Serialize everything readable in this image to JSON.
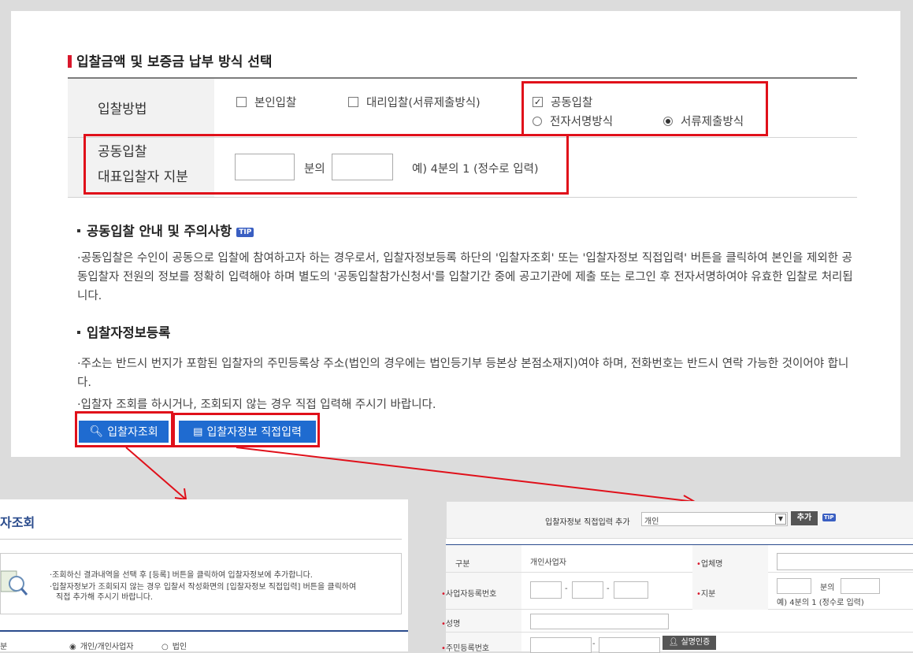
{
  "section_title": "입찰금액 및 보증금 납부 방식 선택",
  "bid_method": {
    "label": "입찰방법",
    "options": [
      {
        "label": "본인입찰",
        "checked": false
      },
      {
        "label": "대리입찰(서류제출방식)",
        "checked": false
      },
      {
        "label": "공동입찰",
        "checked": true
      }
    ],
    "sub_options": [
      {
        "label": "전자서명방식",
        "selected": false
      },
      {
        "label": "서류제출방식",
        "selected": true
      }
    ]
  },
  "joint_share": {
    "label_line1": "공동입찰",
    "label_line2": "대표입찰자 지분",
    "between_text": "분의",
    "example": "예) 4분의 1 (정수로 입력)"
  },
  "guide": {
    "title": "공동입찰 안내 및 주의사항",
    "tip": "TIP",
    "text": "·공동입찰은 수인이 공동으로 입찰에 참여하고자 하는 경우로서, 입찰자정보등록 하단의 '입찰자조회' 또는 '입찰자정보 직접입력' 버튼을 클릭하여 본인을 제외한 공동입찰자 전원의 정보를 정확히 입력해야 하며 별도의 '공동입찰참가신청서'를 입찰기간 중에 공고기관에 제출 또는 로그인 후 전자서명하여야 유효한 입찰로 처리됩니다."
  },
  "register": {
    "title": "입찰자정보등록",
    "note1": "·주소는 반드시 번지가 포함된 입찰자의 주민등록상 주소(법인의 경우에는 법인등기부 등본상 본점소재지)여야 하며, 전화번호는 반드시 연락 가능한 것이어야 합니다.",
    "note2": "·입찰자 조회를 하시거나, 조회되지 않는 경우 직접 입력해 주시기 바랍니다.",
    "search_button": "입찰자조회",
    "direct_button": "입찰자정보 직접입력"
  },
  "search_dialog": {
    "title": "자조회",
    "info1": "·조회하신 결과내역을 선택 후 [등록] 버튼을 클릭하여 입찰자정보에 추가합니다.",
    "info2": "·입찰자정보가 조회되지 않는 경우 입찰서 작성화면의 [입찰자정보 직접입력] 버튼을 클릭하여",
    "info3": "직접 추가해 주시기 바랍니다.",
    "row_label": "분",
    "radio1": "개인/개인사업자",
    "radio2": "법인"
  },
  "direct_panel": {
    "add_label": "입찰자정보 직접입력 추가",
    "select_value": "개인",
    "add_button": "추가",
    "tip": "TIP",
    "type_label": "구분",
    "type_value": "개인사업자",
    "company_label": "업체명",
    "bizno_label": "사업자등록번호",
    "share_label": "지분",
    "share_between": "분의",
    "share_example": "예) 4분의 1 (정수로 입력)",
    "name_label": "성명",
    "rrn_label": "주민등록번호",
    "verify_button": "실명인증"
  },
  "colors": {
    "accent_red": "#e0101a",
    "button_blue": "#1f6bd0"
  }
}
